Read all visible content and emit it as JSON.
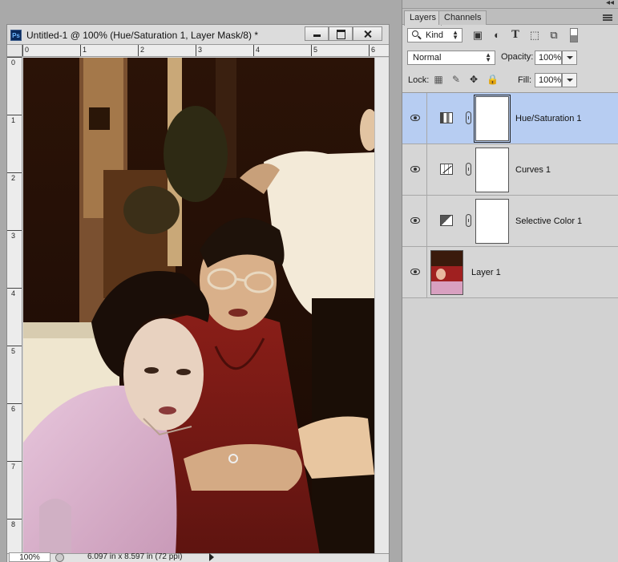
{
  "document": {
    "title": "Untitled-1 @ 100% (Hue/Saturation 1, Layer Mask/8) *",
    "ruler_top": [
      "0",
      "1",
      "2",
      "3",
      "4",
      "5",
      "6"
    ],
    "ruler_left": [
      "0",
      "1",
      "2",
      "3",
      "4",
      "5",
      "6",
      "7",
      "8"
    ],
    "status": {
      "zoom": "100%",
      "info": "6.097 in x 8.597 in (72 ppi)"
    }
  },
  "panel": {
    "collapse_icon": "double-chevron-left-icon",
    "tabs": [
      {
        "label": "Layers",
        "active": true
      },
      {
        "label": "Channels",
        "active": false
      }
    ],
    "filter": {
      "kind_label": "Kind",
      "icons": [
        "image-filter-icon",
        "adjustment-filter-icon",
        "type-filter-icon",
        "shape-filter-icon",
        "smart-object-filter-icon"
      ]
    },
    "blend_mode": "Normal",
    "opacity_label": "Opacity:",
    "opacity_value": "100%",
    "lock_label": "Lock:",
    "lock_icons": [
      "lock-transparent-icon",
      "lock-image-icon",
      "lock-position-icon",
      "lock-all-icon"
    ],
    "fill_label": "Fill:",
    "fill_value": "100%",
    "layers": [
      {
        "name": "Hue/Saturation 1",
        "type": "adjustment",
        "selected": true,
        "visible": true
      },
      {
        "name": "Curves 1",
        "type": "adjustment",
        "selected": false,
        "visible": true
      },
      {
        "name": "Selective Color 1",
        "type": "adjustment",
        "selected": false,
        "visible": true
      },
      {
        "name": "Layer 1",
        "type": "pixel",
        "selected": false,
        "visible": true
      }
    ]
  },
  "colors": {
    "selected_layer": "#b7cdf2",
    "panel_bg": "#d6d6d6",
    "workspace_bg": "#a9a9a9"
  }
}
